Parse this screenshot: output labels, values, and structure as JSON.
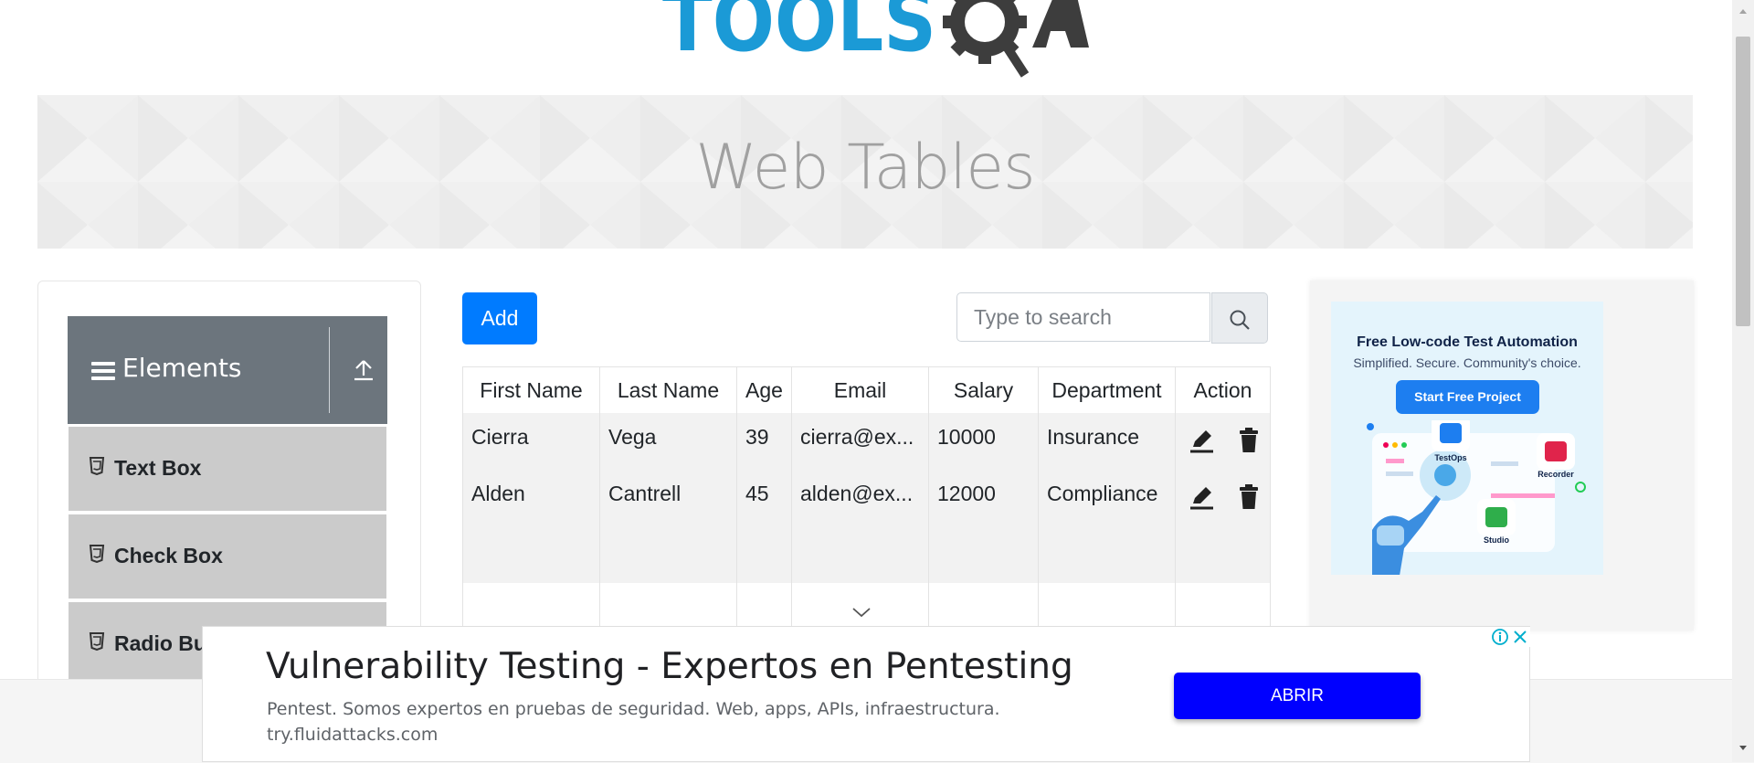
{
  "banner": {
    "title": "Web Tables"
  },
  "sidebar": {
    "group": {
      "title": "Elements"
    },
    "items": [
      {
        "label": "Text Box"
      },
      {
        "label": "Check Box"
      },
      {
        "label": "Radio Button"
      }
    ]
  },
  "toolbar": {
    "add_label": "Add"
  },
  "search": {
    "placeholder": "Type to search",
    "value": ""
  },
  "table": {
    "headers": [
      "First Name",
      "Last Name",
      "Age",
      "Email",
      "Salary",
      "Department",
      "Action"
    ],
    "rows": [
      {
        "first": "Cierra",
        "last": "Vega",
        "age": "39",
        "email": "cierra@ex...",
        "salary": "10000",
        "department": "Insurance"
      },
      {
        "first": "Alden",
        "last": "Cantrell",
        "age": "45",
        "email": "alden@ex...",
        "salary": "12000",
        "department": "Compliance"
      }
    ]
  },
  "ad_right": {
    "title": "Free Low-code Test Automation",
    "subtitle": "Simplified. Secure. Community's choice.",
    "button": "Start Free Project",
    "labels": [
      "TestOps",
      "Recorder",
      "Studio"
    ]
  },
  "ad_bottom": {
    "headline": "Vulnerability Testing - Expertos en Pentesting",
    "description": "Pentest. Somos expertos en pruebas de seguridad. Web, apps, APIs, infraestructura.",
    "url": "try.fluidattacks.com",
    "cta": "ABRIR"
  },
  "colors": {
    "primary": "#007bff",
    "header_gray": "#6c757d",
    "menu_gray": "#cbcbcb",
    "logo_blue": "#1b9ad6",
    "logo_dark": "#3d3d3d",
    "ad_cta": "#0000ff"
  },
  "icons": [
    "logo-toolsqa",
    "hamburger-icon",
    "upload-arrow-icon",
    "html5-icon",
    "search-icon",
    "edit-pencil-icon",
    "trash-icon",
    "chevron-down-icon",
    "info-icon",
    "close-icon"
  ]
}
